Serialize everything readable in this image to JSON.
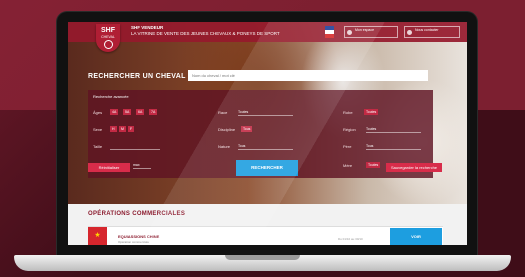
{
  "brand": {
    "mark": "SHF",
    "sub": "CHEVAL"
  },
  "header": {
    "tagline_1": "SHF VENDEUR",
    "tagline_2": "LA VITRINE DE VENTE DES JEUNES CHEVAUX & PONEYS DE SPORT",
    "flag_colors": [
      "#1f3f99",
      "#ffffff",
      "#d62a2a"
    ],
    "btn_account": "Mon espace",
    "btn_contact": "Nous contacter"
  },
  "search": {
    "label": "RECHERCHER UN CHEVAL",
    "placeholder": "Nom du cheval / mot clé"
  },
  "filters": {
    "title": "Recherche avancée",
    "age_label": "Âges",
    "age_values": [
      "4A",
      "5A",
      "6A",
      "7A"
    ],
    "sex_label": "Sexe",
    "sex_values": [
      "H",
      "M",
      "F"
    ],
    "race_label": "Race",
    "race_value": "Toutes",
    "disc_label": "Discipline",
    "disc_value": "Tous",
    "taille_label": "Taille",
    "prix_label": "Prix",
    "prix_values": [
      "min",
      "max"
    ],
    "robe_label": "Robe",
    "robe_value": "Toutes",
    "region_label": "Région",
    "region_value": "Toutes",
    "nature_label": "Nature",
    "nature_value": "Tous",
    "pere_label": "Père",
    "pere_value": "Tous",
    "mere_label": "Mère",
    "mere_value": "Toutes"
  },
  "actions": {
    "reset": "Réinitialiser",
    "search": "RECHERCHER",
    "save": "Sauvegarder la recherche"
  },
  "operations": {
    "title": "OPÉRATIONS COMMERCIALES",
    "card_name": "EQUIASSIONS CHINE",
    "card_sub": "Opération commerciale",
    "card_meta": "Du 01/10 au 30/10",
    "card_btn": "VOIR",
    "card_accent": "#d6262d"
  }
}
